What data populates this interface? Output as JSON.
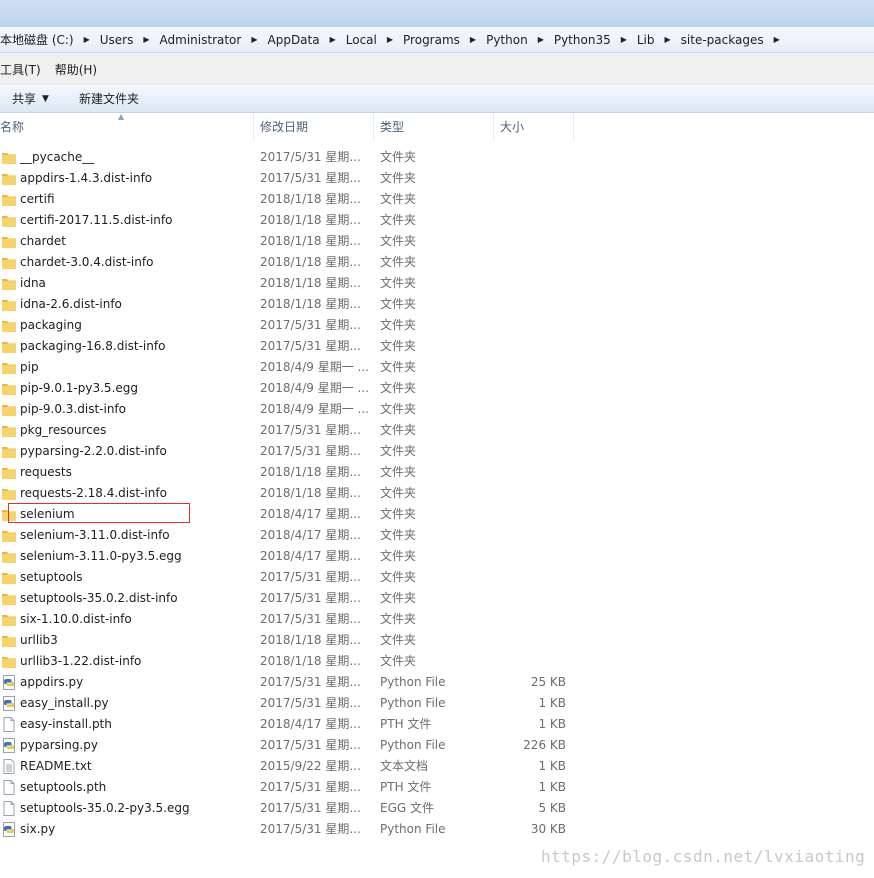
{
  "address": {
    "crumbs": [
      "本地磁盘 (C:)",
      "Users",
      "Administrator",
      "AppData",
      "Local",
      "Programs",
      "Python",
      "Python35",
      "Lib",
      "site-packages"
    ]
  },
  "menu": {
    "items": [
      "工具(T)",
      "帮助(H)"
    ]
  },
  "toolbar": {
    "share_label": "共享",
    "new_folder_label": "新建文件夹"
  },
  "columns": {
    "name": "名称",
    "date": "修改日期",
    "type": "类型",
    "size": "大小"
  },
  "files": [
    {
      "name": "__pycache__",
      "date": "2017/5/31 星期...",
      "type": "文件夹",
      "size": "",
      "icon": "folder-icon"
    },
    {
      "name": "appdirs-1.4.3.dist-info",
      "date": "2017/5/31 星期...",
      "type": "文件夹",
      "size": "",
      "icon": "folder-icon"
    },
    {
      "name": "certifi",
      "date": "2018/1/18 星期...",
      "type": "文件夹",
      "size": "",
      "icon": "folder-icon"
    },
    {
      "name": "certifi-2017.11.5.dist-info",
      "date": "2018/1/18 星期...",
      "type": "文件夹",
      "size": "",
      "icon": "folder-icon"
    },
    {
      "name": "chardet",
      "date": "2018/1/18 星期...",
      "type": "文件夹",
      "size": "",
      "icon": "folder-icon"
    },
    {
      "name": "chardet-3.0.4.dist-info",
      "date": "2018/1/18 星期...",
      "type": "文件夹",
      "size": "",
      "icon": "folder-icon"
    },
    {
      "name": "idna",
      "date": "2018/1/18 星期...",
      "type": "文件夹",
      "size": "",
      "icon": "folder-icon"
    },
    {
      "name": "idna-2.6.dist-info",
      "date": "2018/1/18 星期...",
      "type": "文件夹",
      "size": "",
      "icon": "folder-icon"
    },
    {
      "name": "packaging",
      "date": "2017/5/31 星期...",
      "type": "文件夹",
      "size": "",
      "icon": "folder-icon"
    },
    {
      "name": "packaging-16.8.dist-info",
      "date": "2017/5/31 星期...",
      "type": "文件夹",
      "size": "",
      "icon": "folder-icon"
    },
    {
      "name": "pip",
      "date": "2018/4/9 星期一 ...",
      "type": "文件夹",
      "size": "",
      "icon": "folder-icon"
    },
    {
      "name": "pip-9.0.1-py3.5.egg",
      "date": "2018/4/9 星期一 ...",
      "type": "文件夹",
      "size": "",
      "icon": "folder-icon"
    },
    {
      "name": "pip-9.0.3.dist-info",
      "date": "2018/4/9 星期一 ...",
      "type": "文件夹",
      "size": "",
      "icon": "folder-icon"
    },
    {
      "name": "pkg_resources",
      "date": "2017/5/31 星期...",
      "type": "文件夹",
      "size": "",
      "icon": "folder-icon"
    },
    {
      "name": "pyparsing-2.2.0.dist-info",
      "date": "2017/5/31 星期...",
      "type": "文件夹",
      "size": "",
      "icon": "folder-icon"
    },
    {
      "name": "requests",
      "date": "2018/1/18 星期...",
      "type": "文件夹",
      "size": "",
      "icon": "folder-icon"
    },
    {
      "name": "requests-2.18.4.dist-info",
      "date": "2018/1/18 星期...",
      "type": "文件夹",
      "size": "",
      "icon": "folder-icon"
    },
    {
      "name": "selenium",
      "date": "2018/4/17 星期...",
      "type": "文件夹",
      "size": "",
      "icon": "folder-icon"
    },
    {
      "name": "selenium-3.11.0.dist-info",
      "date": "2018/4/17 星期...",
      "type": "文件夹",
      "size": "",
      "icon": "folder-icon"
    },
    {
      "name": "selenium-3.11.0-py3.5.egg",
      "date": "2018/4/17 星期...",
      "type": "文件夹",
      "size": "",
      "icon": "folder-icon"
    },
    {
      "name": "setuptools",
      "date": "2017/5/31 星期...",
      "type": "文件夹",
      "size": "",
      "icon": "folder-icon"
    },
    {
      "name": "setuptools-35.0.2.dist-info",
      "date": "2017/5/31 星期...",
      "type": "文件夹",
      "size": "",
      "icon": "folder-icon"
    },
    {
      "name": "six-1.10.0.dist-info",
      "date": "2017/5/31 星期...",
      "type": "文件夹",
      "size": "",
      "icon": "folder-icon"
    },
    {
      "name": "urllib3",
      "date": "2018/1/18 星期...",
      "type": "文件夹",
      "size": "",
      "icon": "folder-icon"
    },
    {
      "name": "urllib3-1.22.dist-info",
      "date": "2018/1/18 星期...",
      "type": "文件夹",
      "size": "",
      "icon": "folder-icon"
    },
    {
      "name": "appdirs.py",
      "date": "2017/5/31 星期...",
      "type": "Python File",
      "size": "25 KB",
      "icon": "python-file-icon"
    },
    {
      "name": "easy_install.py",
      "date": "2017/5/31 星期...",
      "type": "Python File",
      "size": "1 KB",
      "icon": "python-file-icon"
    },
    {
      "name": "easy-install.pth",
      "date": "2018/4/17 星期...",
      "type": "PTH 文件",
      "size": "1 KB",
      "icon": "blank-file-icon"
    },
    {
      "name": "pyparsing.py",
      "date": "2017/5/31 星期...",
      "type": "Python File",
      "size": "226 KB",
      "icon": "python-file-icon"
    },
    {
      "name": "README.txt",
      "date": "2015/9/22 星期...",
      "type": "文本文档",
      "size": "1 KB",
      "icon": "text-file-icon"
    },
    {
      "name": "setuptools.pth",
      "date": "2017/5/31 星期...",
      "type": "PTH 文件",
      "size": "1 KB",
      "icon": "blank-file-icon"
    },
    {
      "name": "setuptools-35.0.2-py3.5.egg",
      "date": "2017/5/31 星期...",
      "type": "EGG 文件",
      "size": "5 KB",
      "icon": "blank-file-icon"
    },
    {
      "name": "six.py",
      "date": "2017/5/31 星期...",
      "type": "Python File",
      "size": "30 KB",
      "icon": "python-file-icon"
    }
  ],
  "watermark": "https://blog.csdn.net/lvxiaoting",
  "colors": {
    "folder": "#e8b93a",
    "highlight_box": "#e03030",
    "header_text": "#4c607a"
  }
}
